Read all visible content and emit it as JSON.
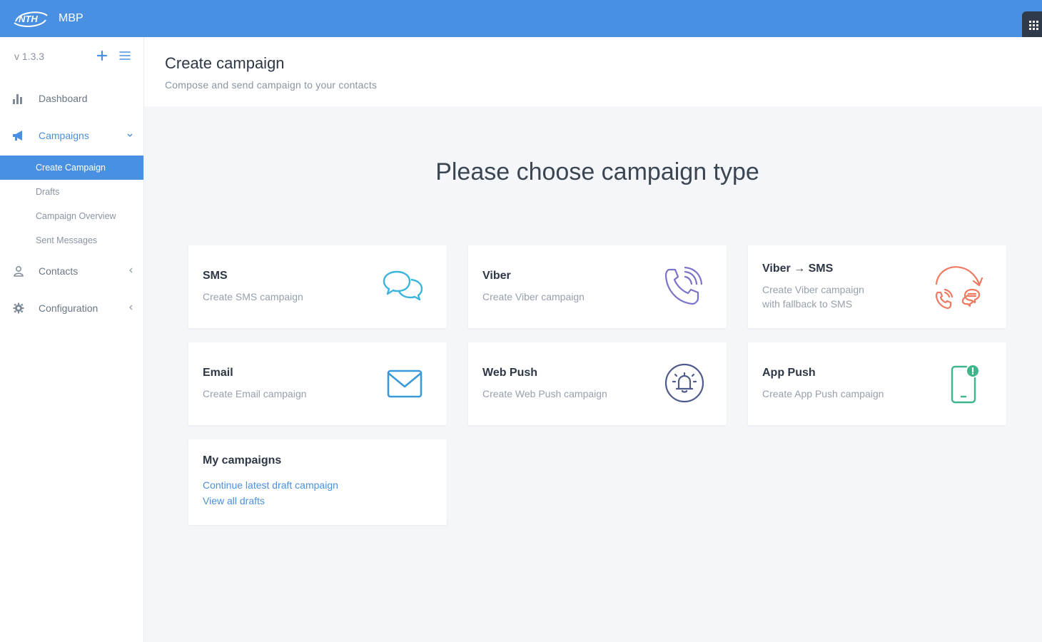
{
  "app": {
    "brand": "MBP",
    "logo_text": "NTH",
    "version": "v 1.3.3"
  },
  "colors": {
    "primary": "#4a90e2",
    "sms": "#3cb4e0",
    "viber": "#7b72c9",
    "viber_sms": "#f07860",
    "email": "#3a9ad9",
    "webpush": "#4e5b8c",
    "apppush": "#3fb58a"
  },
  "sidebar": {
    "items": [
      {
        "label": "Dashboard",
        "icon": "bar-chart-icon"
      },
      {
        "label": "Campaigns",
        "icon": "megaphone-icon",
        "expanded": true,
        "children": [
          {
            "label": "Create Campaign",
            "active": true
          },
          {
            "label": "Drafts"
          },
          {
            "label": "Campaign Overview"
          },
          {
            "label": "Sent Messages"
          }
        ]
      },
      {
        "label": "Contacts",
        "icon": "user-icon"
      },
      {
        "label": "Configuration",
        "icon": "gear-icon"
      }
    ]
  },
  "header": {
    "title": "Create campaign",
    "subtitle": "Compose and send campaign to your contacts"
  },
  "main": {
    "heading": "Please choose campaign type",
    "cards": [
      {
        "title": "SMS",
        "desc": "Create SMS campaign",
        "icon": "chat-bubbles-icon"
      },
      {
        "title": "Viber",
        "desc": "Create Viber campaign",
        "icon": "phone-waves-icon"
      },
      {
        "title": "Viber → SMS",
        "desc_line1": "Create Viber campaign",
        "desc_line2": "with fallback to SMS",
        "icon": "fallback-arrow-icon"
      },
      {
        "title": "Email",
        "desc": "Create Email campaign",
        "icon": "envelope-icon"
      },
      {
        "title": "Web Push",
        "desc": "Create Web Push campaign",
        "icon": "bell-icon"
      },
      {
        "title": "App Push",
        "desc": "Create App Push campaign",
        "icon": "mobile-notification-icon"
      }
    ],
    "my_campaigns": {
      "title": "My campaigns",
      "continue_link": "Continue latest draft campaign",
      "drafts_link": "View all drafts"
    }
  }
}
